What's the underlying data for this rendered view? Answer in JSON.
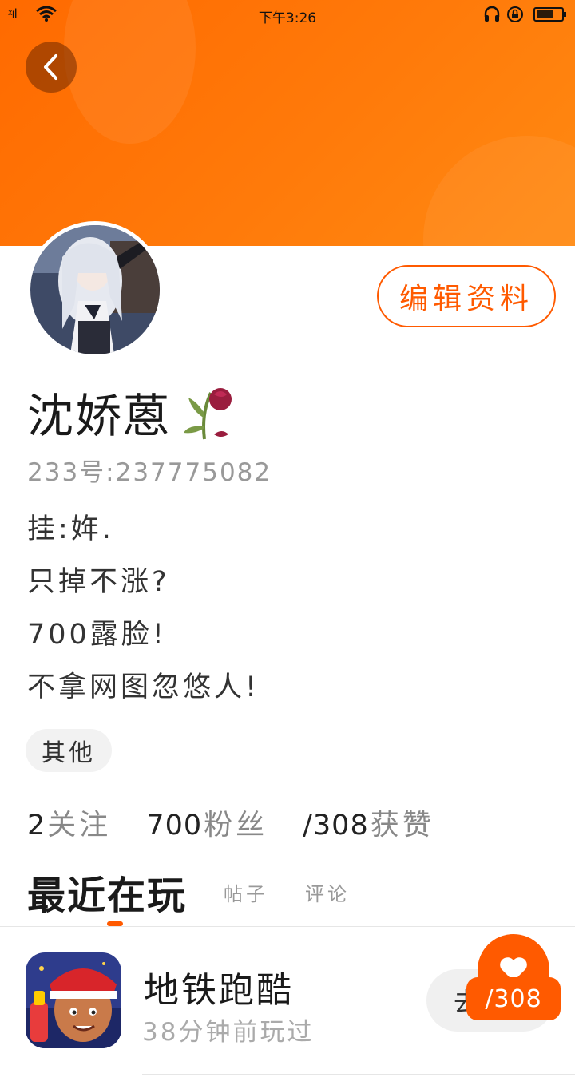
{
  "status_bar": {
    "signal": "ᵡıl",
    "time": "下午3:26"
  },
  "profile": {
    "edit_button": "编辑资料",
    "username": "沈娇蒽",
    "uid": "233号:237775082",
    "bio": [
      "挂:姩.",
      "只掉不涨?",
      "700露脸!",
      "不拿网图忽悠人!"
    ],
    "tag": "其他",
    "stats": [
      {
        "num": "2",
        "label": "关注"
      },
      {
        "num": "700",
        "label": "粉丝"
      },
      {
        "num": "/308",
        "label": "获赞"
      }
    ]
  },
  "tabs": {
    "active": "最近在玩",
    "items": [
      "帖子",
      "评论"
    ]
  },
  "game": {
    "title": "地铁跑酷",
    "meta": "38分钟前玩过",
    "action_glyph": "去"
  },
  "like": {
    "count": "/308"
  },
  "colors": {
    "accent": "#ff5a00",
    "banner": "#ff7a0a"
  },
  "icons": [
    "back-chevron-icon",
    "wifi-icon",
    "headset-icon",
    "rotation-lock-icon",
    "battery-icon",
    "rose-icon",
    "heart-icon"
  ]
}
